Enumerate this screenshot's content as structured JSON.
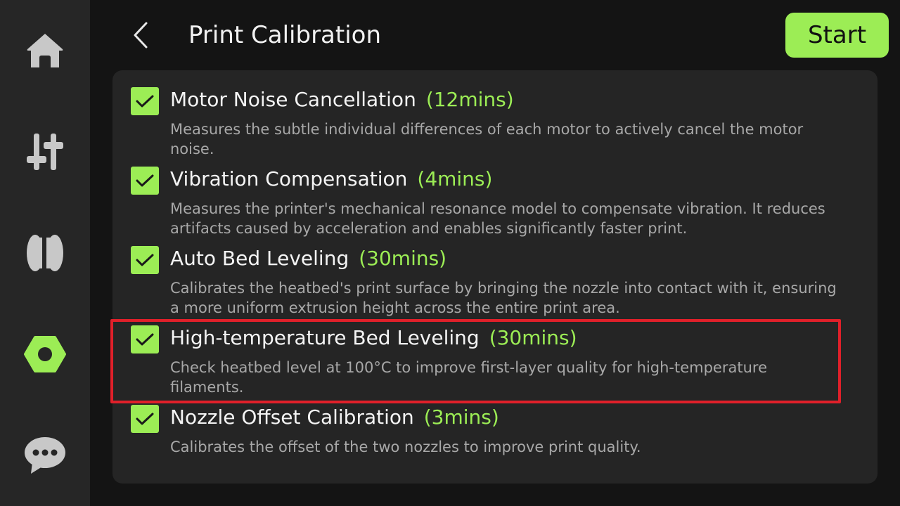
{
  "nav": [
    {
      "id": "home",
      "icon": "home-icon"
    },
    {
      "id": "controls",
      "icon": "sliders-icon"
    },
    {
      "id": "filament",
      "icon": "filament-spool-icon"
    },
    {
      "id": "calibration",
      "icon": "hex-nut-icon",
      "active": true
    },
    {
      "id": "messages",
      "icon": "chat-bubble-icon"
    }
  ],
  "header": {
    "title": "Print Calibration",
    "start_label": "Start",
    "back_icon": "chevron-left-icon"
  },
  "colors": {
    "accent": "#9ced55",
    "background": "#141414",
    "sidebar": "#262626",
    "panel": "#252525",
    "highlight": "#e0202a",
    "description_text": "#a8a8a8"
  },
  "calibrations": [
    {
      "title": "Motor Noise Cancellation",
      "duration": "(12mins)",
      "description": "Measures the subtle individual differences of each motor to actively cancel the motor noise.",
      "checked": true
    },
    {
      "title": "Vibration Compensation",
      "duration": "(4mins)",
      "description": "Measures the printer's mechanical resonance model to compensate vibration. It reduces artifacts caused by acceleration and enables significantly faster print.",
      "checked": true
    },
    {
      "title": "Auto Bed Leveling",
      "duration": "(30mins)",
      "description": "Calibrates the heatbed's print surface by bringing the nozzle into contact with it, ensuring a more uniform extrusion height across the entire print area.",
      "checked": true
    },
    {
      "title": "High-temperature Bed Leveling",
      "duration": "(30mins)",
      "description": "Check heatbed level at 100°C to improve first-layer quality for high-temperature filaments.",
      "checked": true,
      "highlighted": true
    },
    {
      "title": "Nozzle Offset Calibration",
      "duration": "(3mins)",
      "description": "Calibrates the offset of the two nozzles to improve print quality.",
      "checked": true
    }
  ]
}
